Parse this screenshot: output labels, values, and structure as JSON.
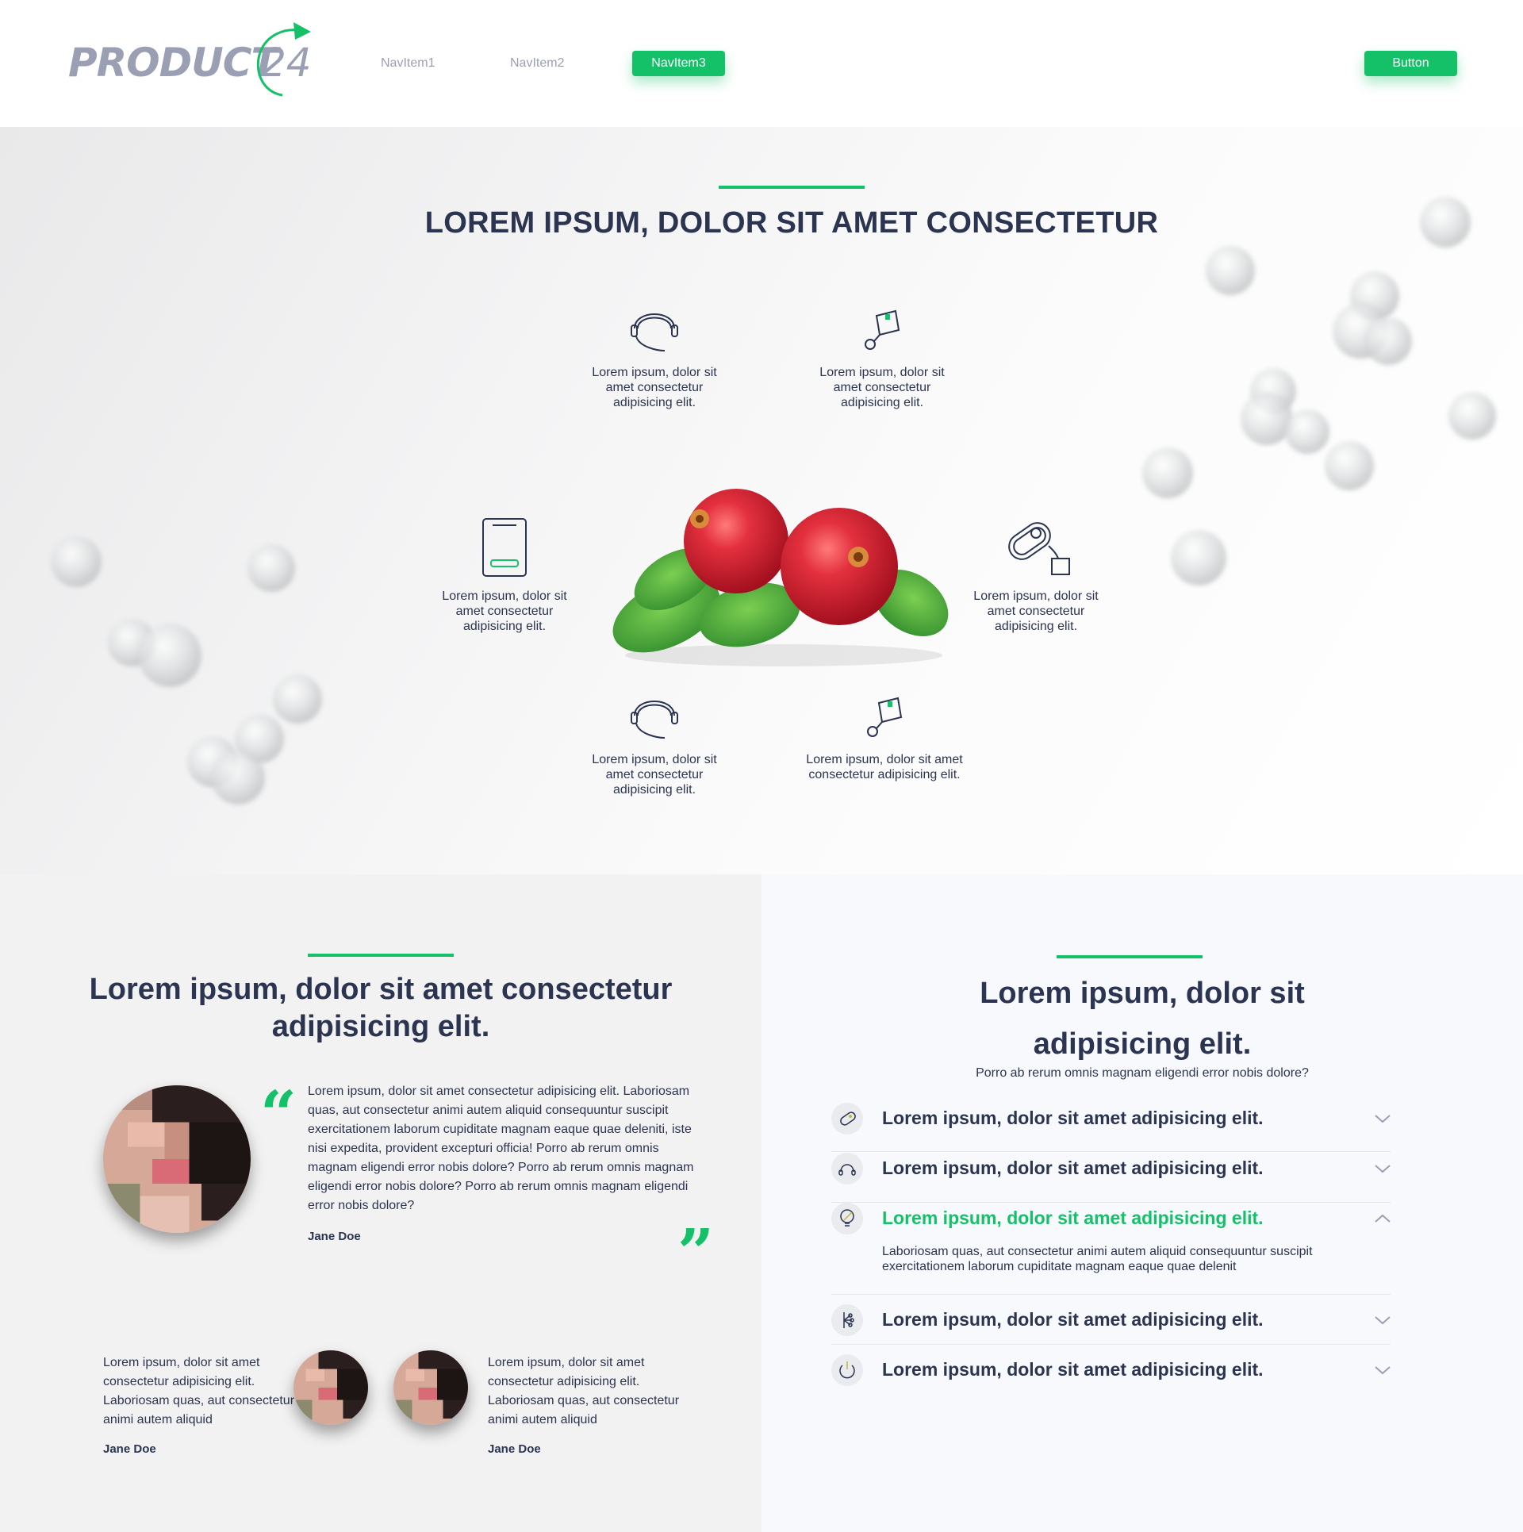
{
  "header": {
    "logo_text": "PRODUCT",
    "logo_number": "24",
    "nav_items": [
      "NavItem1",
      "NavItem2",
      "NavItem3"
    ],
    "active_nav": "NavItem3",
    "button_label": "Button"
  },
  "hero": {
    "title": "LOREM IPSUM, DOLOR SIT AMET CONSECTETUR",
    "features": [
      {
        "icon": "headset-icon",
        "text": "Lorem ipsum, dolor sit amet consectetur adipisicing elit."
      },
      {
        "icon": "package-icon",
        "text": "Lorem ipsum, dolor sit amet consectetur adipisicing elit."
      },
      {
        "icon": "tablet-icon",
        "text": "Lorem ipsum, dolor sit amet consectetur adipisicing elit."
      },
      {
        "icon": "capsule-icon",
        "text": "Lorem ipsum, dolor sit amet consectetur adipisicing elit."
      },
      {
        "icon": "headset-icon",
        "text": "Lorem ipsum, dolor sit amet consectetur adipisicing elit."
      },
      {
        "icon": "package-icon",
        "text": "Lorem ipsum, dolor sit amet consectetur adipisicing elit."
      }
    ]
  },
  "testimonials": {
    "title": "Lorem ipsum, dolor sit amet consectetur adipisicing elit.",
    "main": {
      "text": "Lorem ipsum, dolor sit amet consectetur adipisicing elit. Laboriosam quas, aut consectetur  animi  autem aliquid consequuntur suscipit exercitationem laborum cupiditate magnam eaque quae deleniti, iste nisi  expedita, provident excepturi officia!  Porro ab rerum omnis magnam eligendi error nobis dolore? Porro ab rerum omnis magnam eligendi error nobis dolore? Porro ab rerum omnis magnam eligendi error nobis dolore?",
      "name": "Jane Doe"
    },
    "small": [
      {
        "text": "Lorem ipsum, dolor sit amet consectetur adipisicing elit. Laboriosam quas, aut consectetur  animi  autem aliquid",
        "name": "Jane Doe"
      },
      {
        "text": "Lorem ipsum, dolor sit amet consectetur adipisicing elit. Laboriosam quas, aut consectetur  animi  autem aliquid",
        "name": "Jane Doe"
      }
    ]
  },
  "faq": {
    "title_line1": "Lorem ipsum, dolor sit",
    "title_line2": "adipisicing elit.",
    "subtitle": "Porro ab rerum omnis magnam eligendi error nobis dolore?",
    "items": [
      {
        "icon": "pill-icon",
        "question": "Lorem ipsum, dolor sit amet adipisicing elit.",
        "expanded": false
      },
      {
        "icon": "headset-icon",
        "question": "Lorem ipsum, dolor sit amet adipisicing elit.",
        "expanded": false
      },
      {
        "icon": "lightbulb-icon",
        "question": "Lorem ipsum, dolor sit amet adipisicing elit.",
        "expanded": true,
        "answer": "Laboriosam quas, aut consectetur  animi  autem aliquid  consequuntur suscipit exercitationem laborum cupiditate magnam eaque quae delenit"
      },
      {
        "icon": "network-icon",
        "question": "Lorem ipsum, dolor sit amet adipisicing elit.",
        "expanded": false
      },
      {
        "icon": "power-icon",
        "question": "Lorem ipsum, dolor sit amet adipisicing elit.",
        "expanded": false
      }
    ]
  },
  "colors": {
    "accent": "#14c068",
    "text": "#2b3450",
    "muted": "#9a9fb4"
  }
}
